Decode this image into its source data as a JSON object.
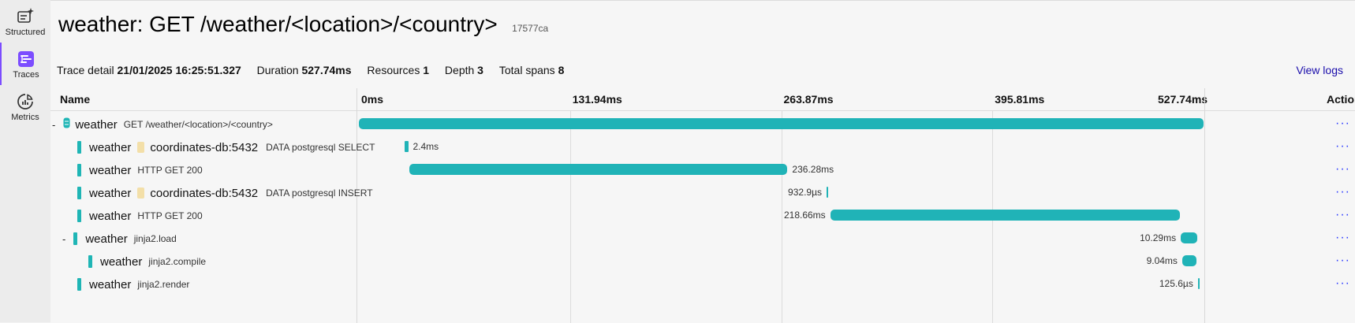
{
  "nav": {
    "items": [
      {
        "label": "Structured",
        "icon": "structured-logs-icon",
        "active": false
      },
      {
        "label": "Traces",
        "icon": "traces-icon",
        "active": true
      },
      {
        "label": "Metrics",
        "icon": "metrics-icon",
        "active": false
      }
    ]
  },
  "header": {
    "title": "weather: GET /weather/<location>/<country>",
    "trace_id": "17577ca"
  },
  "summary": {
    "trace_detail_label": "Trace detail",
    "trace_detail_value": "21/01/2025 16:25:51.327",
    "duration_label": "Duration",
    "duration_value": "527.74ms",
    "resources_label": "Resources",
    "resources_value": "1",
    "depth_label": "Depth",
    "depth_value": "3",
    "total_spans_label": "Total spans",
    "total_spans_value": "8",
    "view_logs": "View logs"
  },
  "table": {
    "name_header": "Name",
    "actions_header": "Actions",
    "ticks": [
      "0ms",
      "131.94ms",
      "263.87ms",
      "395.81ms",
      "527.74ms"
    ],
    "total_ms": 527.74,
    "colors": {
      "bar": "#20b3b7",
      "accent": "#7c4dff",
      "link": "#1a0dab"
    },
    "spans": [
      {
        "toggle": "-",
        "service": "weather",
        "db": "",
        "op": "GET /weather/<location>/<country>",
        "start_ms": 0,
        "dur_ms": 527.74,
        "dur_label": "",
        "depth": 0,
        "root": true
      },
      {
        "toggle": "",
        "service": "weather",
        "db": "coordinates-db:5432",
        "op": "DATA postgresql SELECT",
        "start_ms": 28.4,
        "dur_ms": 2.4,
        "dur_label": "2.4ms",
        "depth": 1,
        "root": false
      },
      {
        "toggle": "",
        "service": "weather",
        "db": "",
        "op": "HTTP GET 200",
        "start_ms": 31.5,
        "dur_ms": 236.28,
        "dur_label": "236.28ms",
        "depth": 1,
        "root": false
      },
      {
        "toggle": "",
        "service": "weather",
        "db": "coordinates-db:5432",
        "op": "DATA postgresql INSERT",
        "start_ms": 292.2,
        "dur_ms": 0.9329,
        "dur_label": "932.9µs",
        "depth": 1,
        "root": false
      },
      {
        "toggle": "",
        "service": "weather",
        "db": "",
        "op": "HTTP GET 200",
        "start_ms": 294.5,
        "dur_ms": 218.66,
        "dur_label": "218.66ms",
        "depth": 1,
        "root": false
      },
      {
        "toggle": "-",
        "service": "weather",
        "db": "",
        "op": "jinja2.load",
        "start_ms": 513.5,
        "dur_ms": 10.29,
        "dur_label": "10.29ms",
        "depth": 1,
        "root": false
      },
      {
        "toggle": "",
        "service": "weather",
        "db": "",
        "op": "jinja2.compile",
        "start_ms": 514.4,
        "dur_ms": 9.04,
        "dur_label": "9.04ms",
        "depth": 2,
        "root": false
      },
      {
        "toggle": "",
        "service": "weather",
        "db": "",
        "op": "jinja2.render",
        "start_ms": 524.2,
        "dur_ms": 0.1256,
        "dur_label": "125.6µs",
        "depth": 1,
        "root": false
      }
    ]
  }
}
